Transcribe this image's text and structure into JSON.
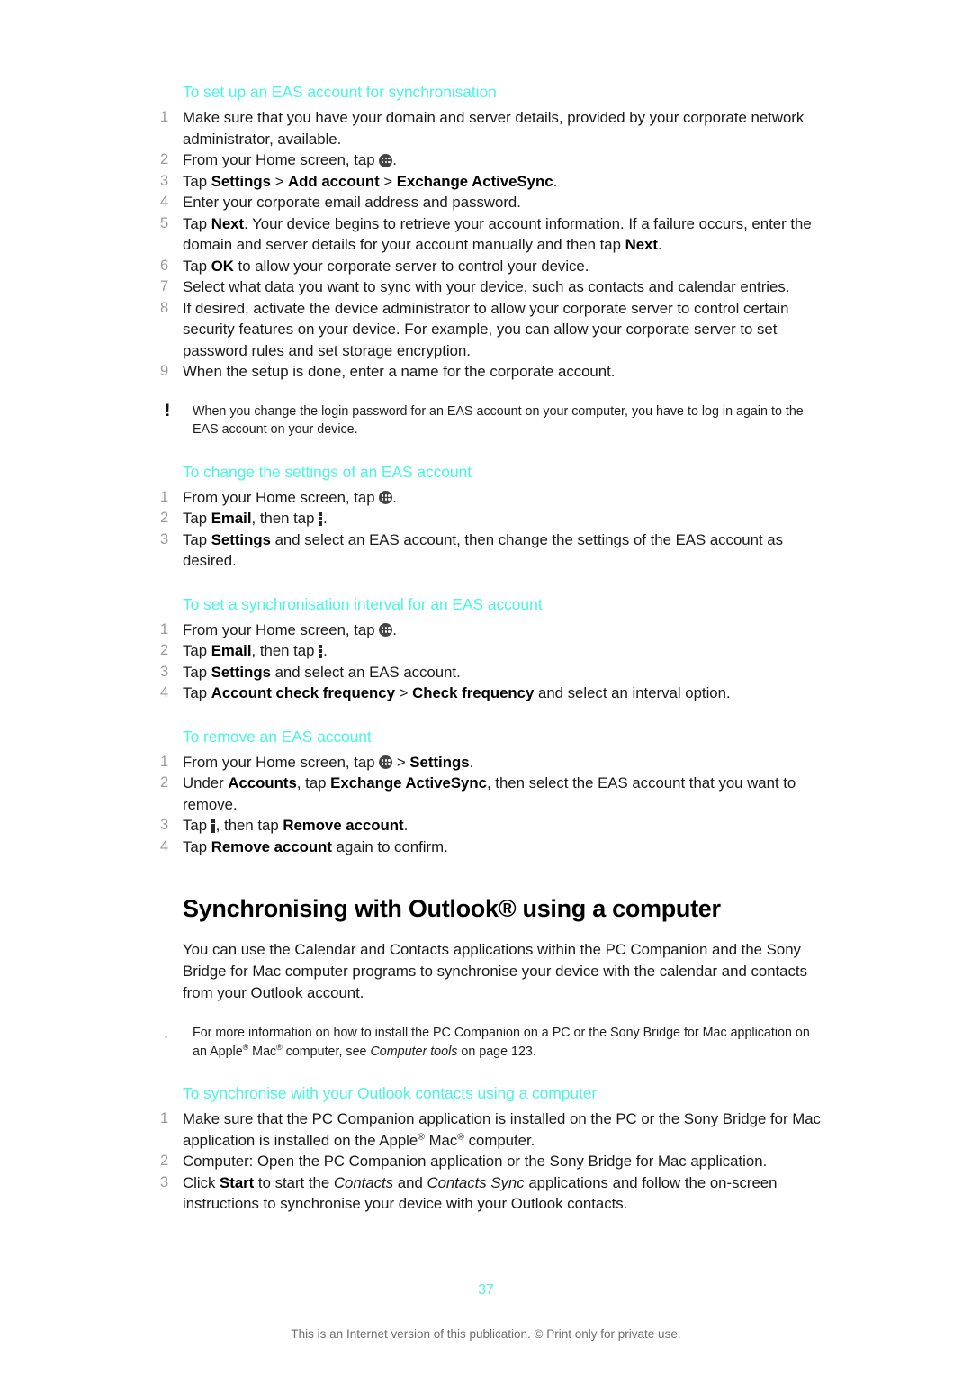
{
  "document": {
    "page_number": "37",
    "footer_text": "This is an Internet version of this publication. © Print only for private use.",
    "accent_color": "#4AF5E2",
    "number_color": "#9a9a9a"
  },
  "sections": {
    "setup_eas": {
      "heading": "To set up an EAS account for synchronisation",
      "steps": [
        {
          "num": "1",
          "text": "Make sure that you have your domain and server details, provided by your corporate network administrator, available."
        },
        {
          "num": "2",
          "text_before": "From your Home screen, tap ",
          "icon": "app-drawer-icon",
          "text_after": "."
        },
        {
          "num": "3",
          "text": "Tap Settings > Add account > Exchange ActiveSync."
        },
        {
          "num": "4",
          "text": "Enter your corporate email address and password."
        },
        {
          "num": "5",
          "text": "Tap Next. Your device begins to retrieve your account information. If a failure occurs, enter the domain and server details for your account manually and then tap Next."
        },
        {
          "num": "6",
          "text": "Tap OK to allow your corporate server to control your device."
        },
        {
          "num": "7",
          "text": "Select what data you want to sync with your device, such as contacts and calendar entries."
        },
        {
          "num": "8",
          "text": "If desired, activate the device administrator to allow your corporate server to control certain security features on your device. For example, you can allow your corporate server to set password rules and set storage encryption."
        },
        {
          "num": "9",
          "text": "When the setup is done, enter a name for the corporate account."
        }
      ],
      "note": "When you change the login password for an EAS account on your computer, you have to log in again to the EAS account on your device."
    },
    "change_settings": {
      "heading": "To change the settings of an EAS account",
      "steps": [
        {
          "num": "1",
          "text_before": "From your Home screen, tap ",
          "icon": "app-drawer-icon",
          "text_after": "."
        },
        {
          "num": "2",
          "text_before": "Tap Email, then tap ",
          "icon": "overflow-menu-icon",
          "text_after": "."
        },
        {
          "num": "3",
          "text": "Tap Settings and select an EAS account, then change the settings of the EAS account as desired."
        }
      ]
    },
    "sync_interval": {
      "heading": "To set a synchronisation interval for an EAS account",
      "steps": [
        {
          "num": "1",
          "text_before": "From your Home screen, tap ",
          "icon": "app-drawer-icon",
          "text_after": "."
        },
        {
          "num": "2",
          "text_before": "Tap Email, then tap ",
          "icon": "overflow-menu-icon",
          "text_after": "."
        },
        {
          "num": "3",
          "text": "Tap Settings and select an EAS account."
        },
        {
          "num": "4",
          "text": "Tap Account check frequency > Check frequency and select an interval option."
        }
      ]
    },
    "remove_account": {
      "heading": "To remove an EAS account",
      "steps": [
        {
          "num": "1",
          "text_before": "From your Home screen, tap ",
          "icon": "app-drawer-icon",
          "text_after": " > Settings."
        },
        {
          "num": "2",
          "text": "Under Accounts, tap Exchange ActiveSync, then select the EAS account that you want to remove."
        },
        {
          "num": "3",
          "text_before": "Tap ",
          "icon": "overflow-menu-icon",
          "text_after": ", then tap Remove account."
        },
        {
          "num": "4",
          "text": "Tap Remove account again to confirm."
        }
      ]
    },
    "outlook": {
      "title": "Synchronising with Outlook® using a computer",
      "intro": "You can use the Calendar and Contacts applications within the PC Companion and the Sony Bridge for Mac computer programs to synchronise your device with the calendar and contacts from your Outlook account.",
      "tip": "For more information on how to install the PC Companion on a PC or the Sony Bridge for Mac application on an Apple® Mac® computer, see Computer tools on page 123.",
      "tip_italic_phrase": "Computer tools",
      "tip_page_ref": "123",
      "sub_heading": "To synchronise with your Outlook contacts using a computer",
      "steps": [
        {
          "num": "1",
          "text": "Make sure that the PC Companion application is installed on the PC or the Sony Bridge for Mac application is installed on the Apple® Mac® computer."
        },
        {
          "num": "2",
          "text": "Computer: Open the PC Companion application or the Sony Bridge for Mac application."
        },
        {
          "num": "3",
          "text": "Click Start to start the Contacts and Contacts Sync applications and follow the on-screen instructions to synchronise your device with your Outlook contacts."
        }
      ]
    }
  }
}
